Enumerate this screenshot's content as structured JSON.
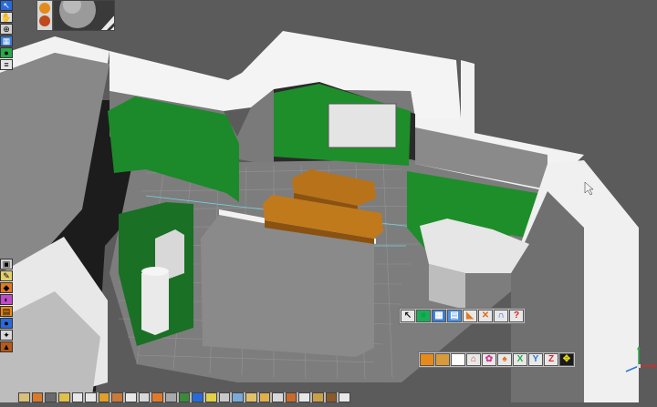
{
  "viewport": {
    "background": "#5b5b5b",
    "wall_green": "#1e8e2a",
    "sofa_color": "#c07a1c"
  },
  "left_toolbar": {
    "icons": [
      "arrow-icon",
      "hand-icon",
      "zoom-icon",
      "grid-icon",
      "color-icon",
      "layer-icon",
      "select-icon",
      "move-icon"
    ]
  },
  "left_toolbar_lower": {
    "icons": [
      "camera-icon",
      "pencil-icon",
      "brush-icon",
      "palette-icon",
      "layer-stack-icon",
      "sphere-icon",
      "wrench-icon",
      "hammer-icon"
    ]
  },
  "material_strip": {
    "colors": [
      "#e38b1a",
      "#c04a1a"
    ]
  },
  "toolbar_top": {
    "icons": [
      {
        "name": "cursor-icon",
        "glyph": "↖",
        "color": "#f2f2f2"
      },
      {
        "name": "box-icon",
        "glyph": "■",
        "color": "#1faa5a"
      },
      {
        "name": "grid-icon",
        "glyph": "▦",
        "color": "#3a7dd8"
      },
      {
        "name": "floor-icon",
        "glyph": "▤",
        "color": "#4a8fe0"
      },
      {
        "name": "chair-icon",
        "glyph": "◣",
        "color": "#e07a20"
      },
      {
        "name": "tools-icon",
        "glyph": "✕",
        "color": "#e06a1a"
      },
      {
        "name": "magnet-icon",
        "glyph": "∩",
        "color": "#2a5fc8"
      },
      {
        "name": "help-icon",
        "glyph": "?",
        "color": "#d82020"
      }
    ]
  },
  "toolbar_bottom": {
    "icons": [
      {
        "name": "orange-cube-icon",
        "glyph": "■",
        "color": "#e68a1c"
      },
      {
        "name": "wood-cube-icon",
        "glyph": "■",
        "color": "#d89a3a"
      },
      {
        "name": "white-square-icon",
        "glyph": "□",
        "color": "#ffffff"
      },
      {
        "name": "house-icon",
        "glyph": "⌂",
        "color": "#d04a2a"
      },
      {
        "name": "flower-icon",
        "glyph": "✿",
        "color": "#c83c8c"
      },
      {
        "name": "lamp-icon",
        "glyph": "♠",
        "color": "#e06a1a"
      },
      {
        "name": "axis-x-icon",
        "label": "X",
        "color": "#2aa84a"
      },
      {
        "name": "axis-y-icon",
        "label": "Y",
        "color": "#2a74d8"
      },
      {
        "name": "axis-z-icon",
        "label": "Z",
        "color": "#d82a2a"
      },
      {
        "name": "move-all-icon",
        "glyph": "✥",
        "color": "#e0d81a"
      }
    ]
  },
  "bottom_bar": {
    "icons": [
      "wall-icon",
      "door-icon",
      "window-icon",
      "stair-icon",
      "roof-icon",
      "circle-icon",
      "flame-icon",
      "tree-icon",
      "heart-icon",
      "lamp-icon",
      "cabinet-icon",
      "cube-icon",
      "plant-icon",
      "person-icon",
      "light-icon",
      "shelf-icon",
      "terrain-icon",
      "texture-icon",
      "gem-icon",
      "fabric-icon",
      "roof-tile-icon",
      "sign-icon",
      "chair-icon",
      "table-icon",
      "star-icon"
    ]
  },
  "axis_gizmo": {
    "x": "X",
    "y": "Y",
    "z": "Z"
  }
}
